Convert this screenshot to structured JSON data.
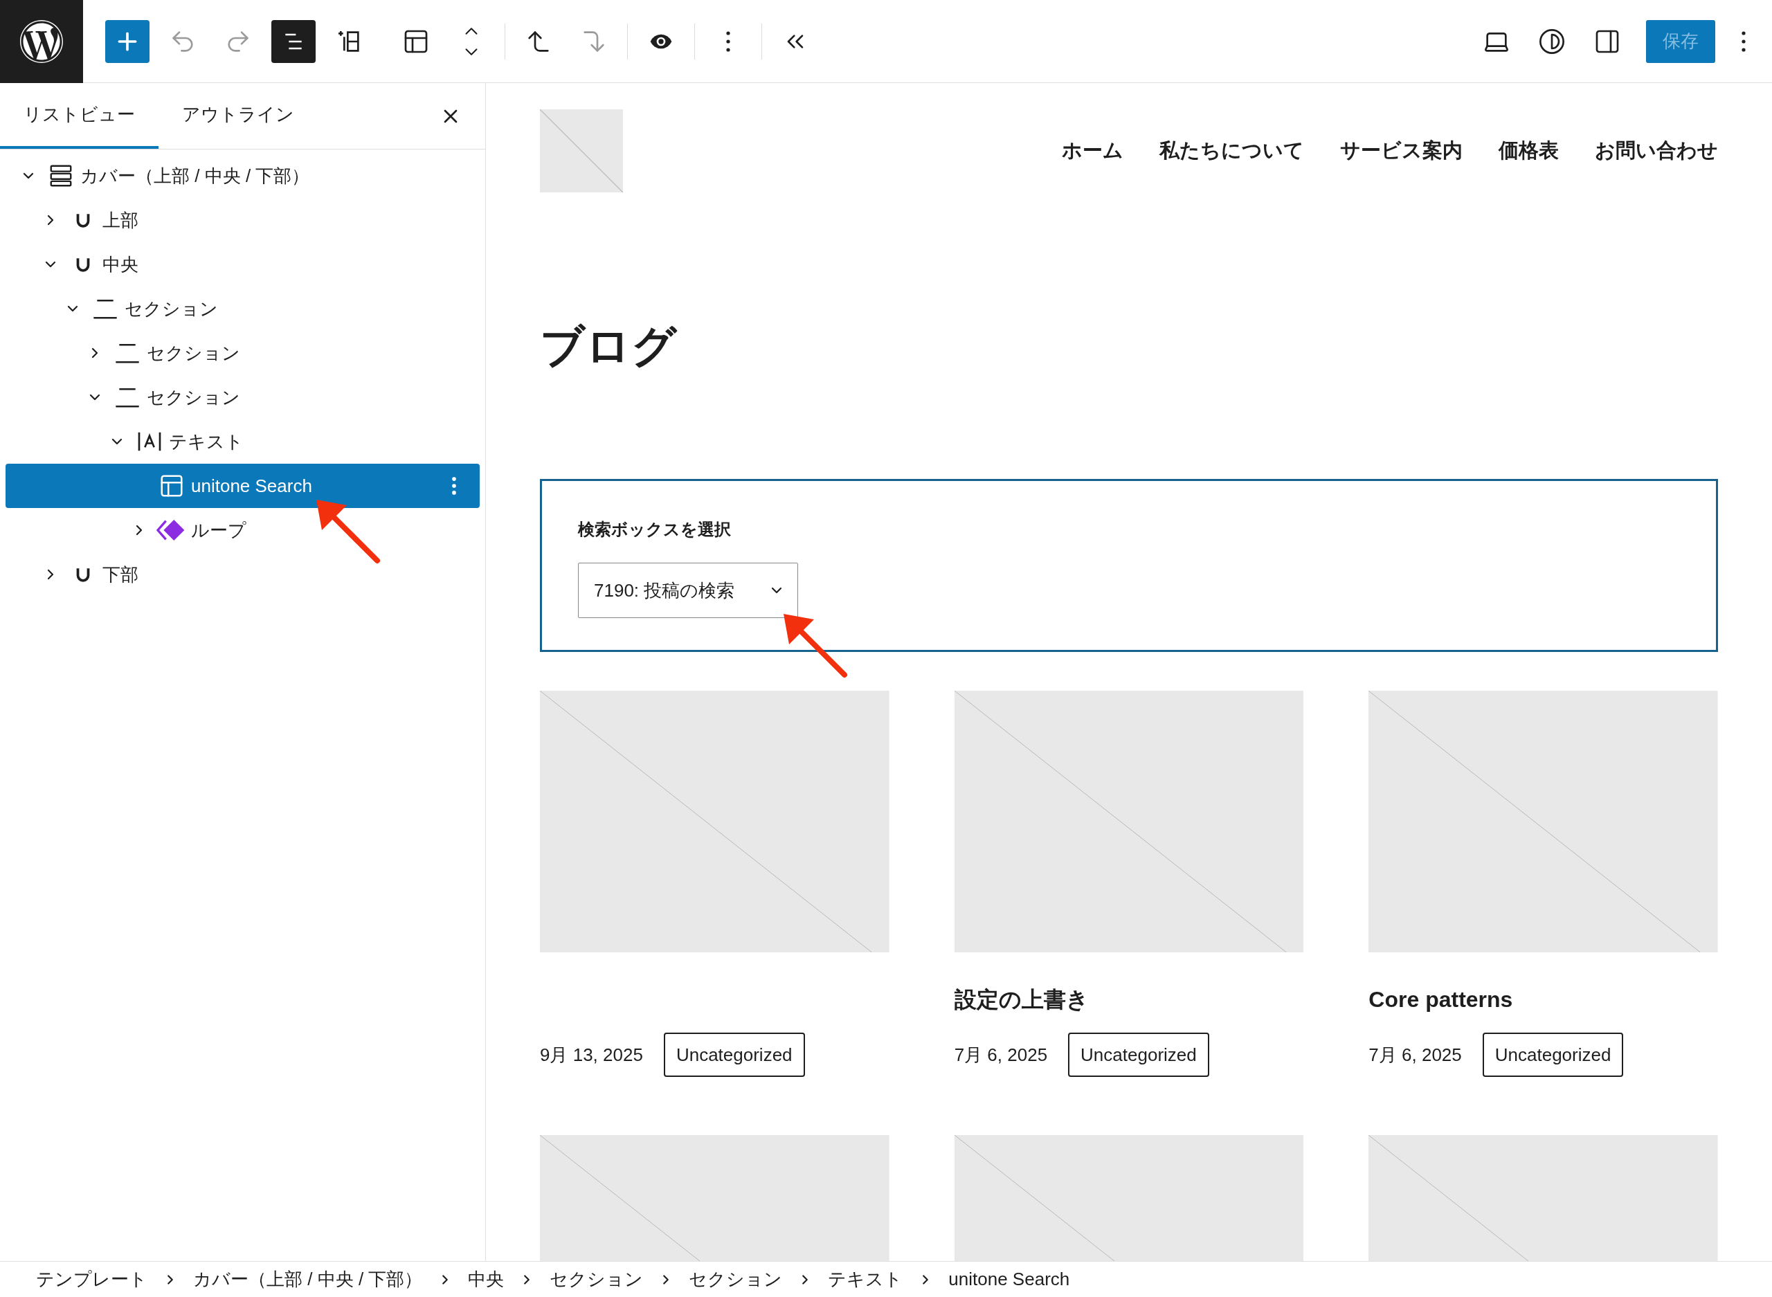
{
  "toolbar": {
    "add": {
      "kind": "add"
    },
    "left": [
      {
        "kind": "undo",
        "disabled": true,
        "pressed": false
      },
      {
        "kind": "redo",
        "disabled": true,
        "pressed": false
      },
      {
        "kind": "list-view",
        "disabled": false,
        "pressed": true
      },
      {
        "kind": "inserter",
        "disabled": false,
        "pressed": false
      },
      {
        "kind": "layout",
        "disabled": false,
        "pressed": false
      },
      {
        "kind": "move",
        "disabled": false,
        "pressed": false
      },
      {
        "kind": "parent",
        "disabled": false,
        "pressed": false
      },
      {
        "kind": "child",
        "disabled": true,
        "pressed": false
      },
      {
        "kind": "preview",
        "disabled": false,
        "pressed": false
      },
      {
        "kind": "more",
        "disabled": false,
        "pressed": false
      },
      {
        "kind": "collapse",
        "disabled": false,
        "pressed": false
      }
    ],
    "right": [
      {
        "kind": "device"
      },
      {
        "kind": "styles"
      },
      {
        "kind": "settings"
      }
    ],
    "save": {
      "label": "保存",
      "disabled": true
    }
  },
  "sidebar": {
    "tabs": [
      {
        "label": "リストビュー",
        "selected": true
      },
      {
        "label": "アウトライン",
        "selected": false
      }
    ],
    "tree": [
      {
        "kind": "cover",
        "label": "カバー（上部 / 中央 / 下部）",
        "expanded": true,
        "selected": false,
        "children": [
          {
            "kind": "group",
            "label": "上部",
            "expanded": false,
            "selected": false
          },
          {
            "kind": "group",
            "label": "中央",
            "expanded": true,
            "selected": false,
            "children": [
              {
                "kind": "section",
                "label": "セクション",
                "expanded": true,
                "selected": false,
                "children": [
                  {
                    "kind": "section",
                    "label": "セクション",
                    "expanded": false,
                    "selected": false
                  },
                  {
                    "kind": "section",
                    "label": "セクション",
                    "expanded": true,
                    "selected": false,
                    "children": [
                      {
                        "kind": "text",
                        "label": "テキスト",
                        "expanded": true,
                        "selected": false,
                        "children": [
                          {
                            "kind": "search",
                            "label": "unitone Search",
                            "selected": true
                          },
                          {
                            "kind": "loop",
                            "label": "ループ",
                            "expanded": false,
                            "selected": false
                          }
                        ]
                      }
                    ]
                  }
                ]
              }
            ]
          },
          {
            "kind": "group",
            "label": "下部",
            "expanded": false,
            "selected": false
          }
        ]
      }
    ]
  },
  "page": {
    "nav": [
      "ホーム",
      "私たちについて",
      "サービス案内",
      "価格表",
      "お問い合わせ"
    ],
    "heading": "ブログ",
    "search_block": {
      "label": "検索ボックスを選択",
      "value": "7190: 投稿の検索"
    },
    "cards": [
      {
        "kind": "post",
        "date": "9月 13, 2025",
        "category": "Uncategorized"
      },
      {
        "kind": "post",
        "title": "設定の上書き",
        "date": "7月 6, 2025",
        "category": "Uncategorized"
      },
      {
        "kind": "post",
        "title": "Core patterns",
        "date": "7月 6, 2025",
        "category": "Uncategorized"
      },
      {
        "kind": "image-only"
      },
      {
        "kind": "image-only"
      },
      {
        "kind": "image-only"
      }
    ]
  },
  "breadcrumb": [
    "テンプレート",
    "カバー（上部 / 中央 / 下部）",
    "中央",
    "セクション",
    "セクション",
    "テキスト",
    "unitone Search"
  ]
}
